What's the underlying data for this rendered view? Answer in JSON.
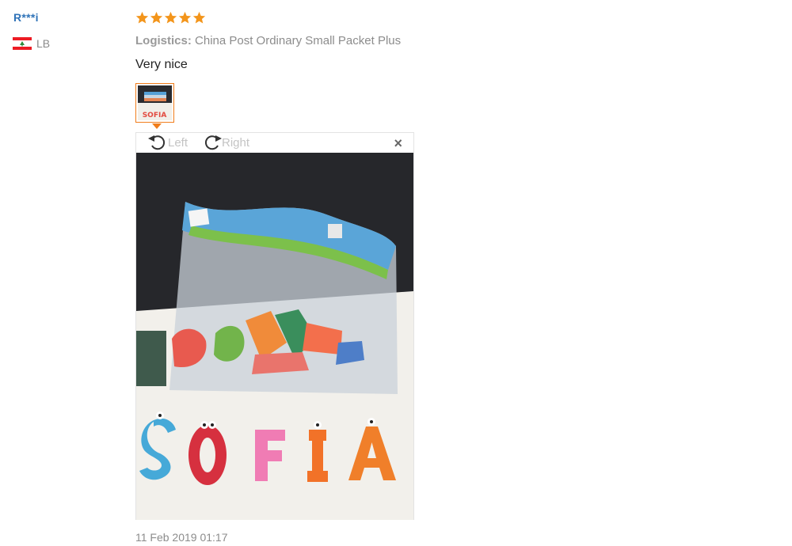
{
  "reviewer": {
    "name": "R***i",
    "country_code": "LB"
  },
  "review": {
    "rating": 5,
    "star_color": "#f3951b",
    "logistics_label": "Logistics:",
    "logistics_value": "China Post Ordinary Small Packet Plus",
    "text": "Very nice",
    "date": "11 Feb 2019 01:17",
    "photo_text": "SOFIA"
  },
  "viewer": {
    "rotate_left_label": "Left",
    "rotate_right_label": "Right",
    "close_label": "×"
  }
}
